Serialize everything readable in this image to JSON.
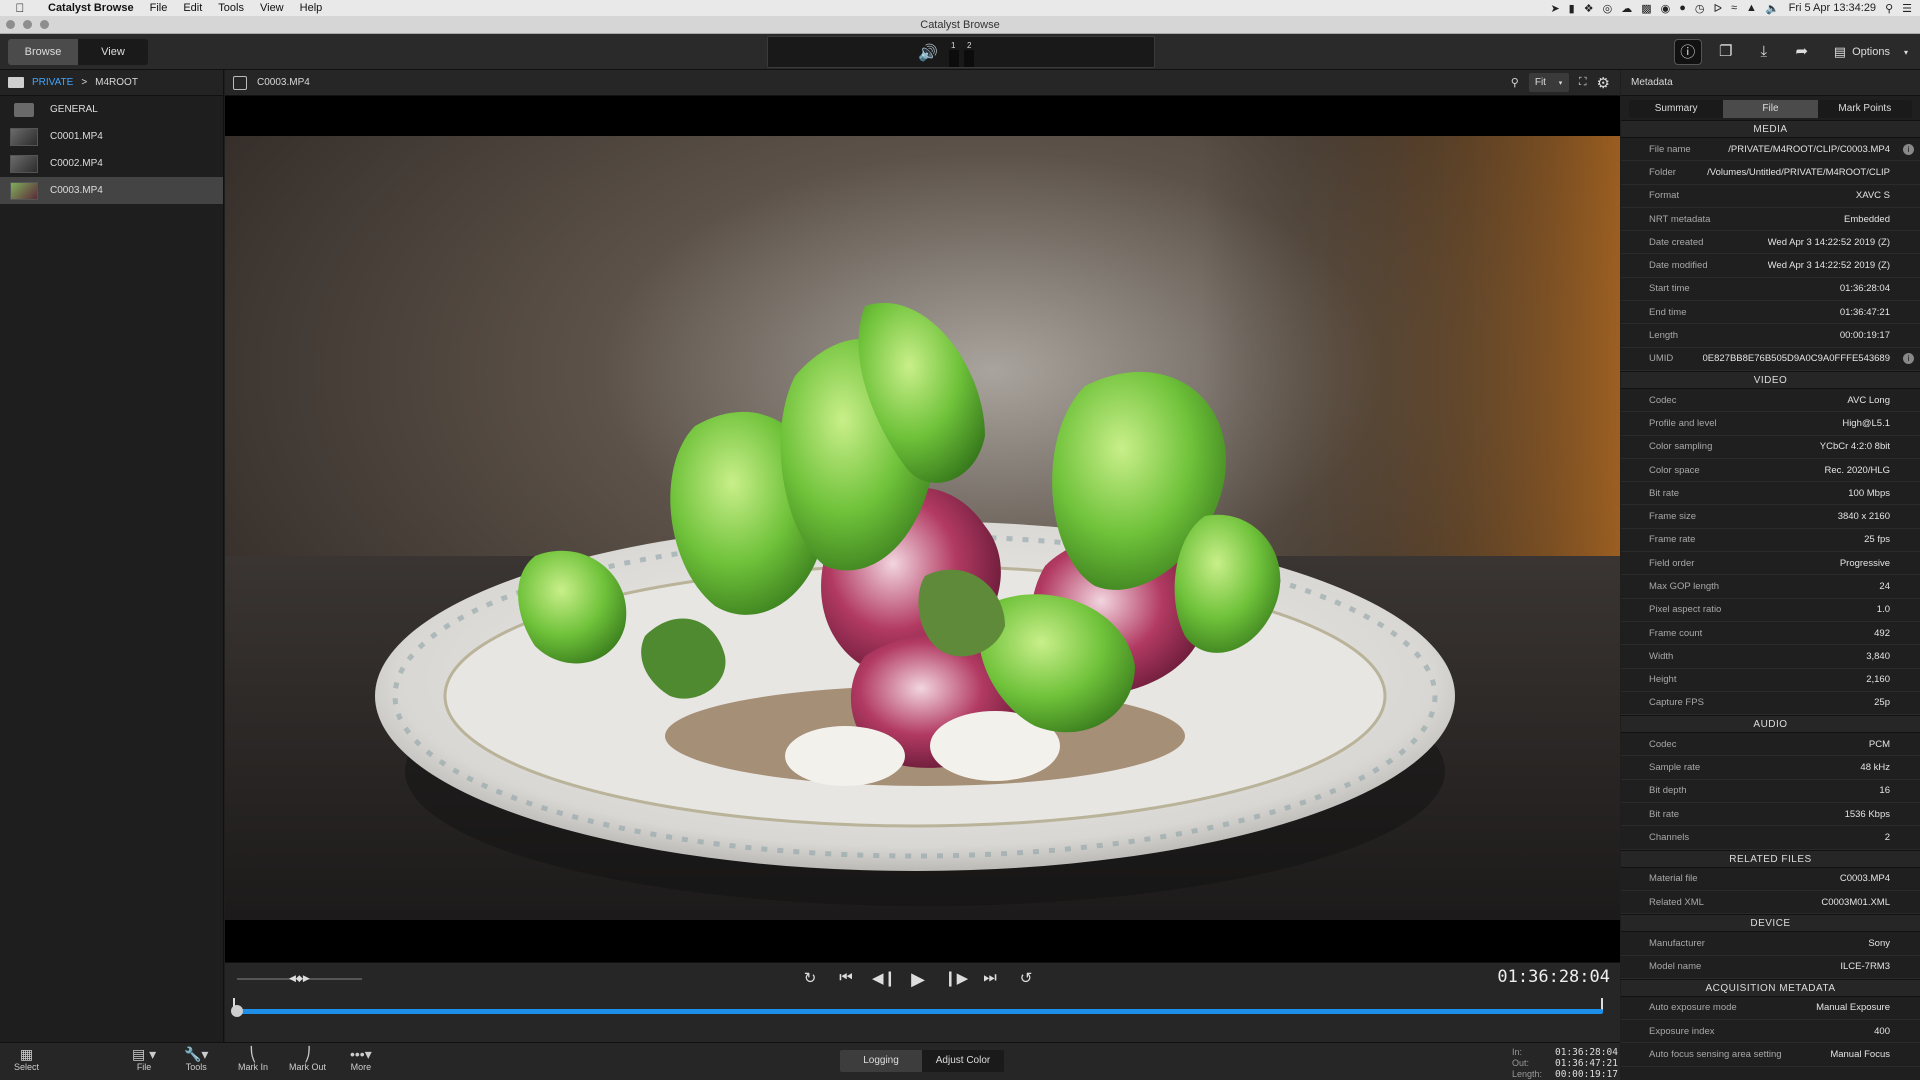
{
  "menubar": {
    "app": "Catalyst Browse",
    "items": [
      "File",
      "Edit",
      "Tools",
      "View",
      "Help"
    ],
    "clock": "Fri 5 Apr  13:34:29"
  },
  "window": {
    "title": "Catalyst Browse"
  },
  "toolbar": {
    "browse_label": "Browse",
    "view_label": "View",
    "audio_ch1": "1",
    "audio_ch2": "2",
    "options_label": "Options"
  },
  "browser": {
    "breadcrumb_root": "PRIVATE",
    "breadcrumb_sep": ">",
    "breadcrumb_current": "M4ROOT",
    "items": [
      {
        "label": "GENERAL",
        "type": "folder"
      },
      {
        "label": "C0001.MP4",
        "type": "clip"
      },
      {
        "label": "C0002.MP4",
        "type": "clip"
      },
      {
        "label": "C0003.MP4",
        "type": "clip",
        "selected": true
      }
    ]
  },
  "viewer": {
    "clip_name": "C0003.MP4",
    "fit_label": "Fit",
    "timecode": "01:36:28:04",
    "playhead_fraction": 0.0
  },
  "bottombar": {
    "select": "Select",
    "file": "File",
    "tools": "Tools",
    "mark_in": "Mark In",
    "mark_out": "Mark Out",
    "more": "More",
    "logging": "Logging",
    "adjust_color": "Adjust Color",
    "in_label": "In:",
    "out_label": "Out:",
    "length_label": "Length:",
    "in_value": "01:36:28:04",
    "out_value": "01:36:47:21",
    "length_value": "00:00:19:17"
  },
  "metadata": {
    "header": "Metadata",
    "tabs": [
      "Summary",
      "File",
      "Mark Points"
    ],
    "active_tab": "File",
    "sections": [
      {
        "title": "MEDIA",
        "rows": [
          {
            "k": "File name",
            "v": "/PRIVATE/M4ROOT/CLIP/C0003.MP4",
            "info": true
          },
          {
            "k": "Folder",
            "v": "/Volumes/Untitled/PRIVATE/M4ROOT/CLIP"
          },
          {
            "k": "Format",
            "v": "XAVC S"
          },
          {
            "k": "NRT metadata",
            "v": "Embedded"
          },
          {
            "k": "Date created",
            "v": "Wed Apr  3 14:22:52 2019 (Z)"
          },
          {
            "k": "Date modified",
            "v": "Wed Apr  3 14:22:52 2019 (Z)"
          },
          {
            "k": "Start time",
            "v": "01:36:28:04"
          },
          {
            "k": "End time",
            "v": "01:36:47:21"
          },
          {
            "k": "Length",
            "v": "00:00:19:17"
          },
          {
            "k": "UMID",
            "v": "0E827BB8E76B505D9A0C9A0FFFE543689",
            "info": true
          }
        ]
      },
      {
        "title": "VIDEO",
        "rows": [
          {
            "k": "Codec",
            "v": "AVC Long"
          },
          {
            "k": "Profile and level",
            "v": "High@L5.1"
          },
          {
            "k": "Color sampling",
            "v": "YCbCr 4:2:0 8bit"
          },
          {
            "k": "Color space",
            "v": "Rec. 2020/HLG"
          },
          {
            "k": "Bit rate",
            "v": "100 Mbps"
          },
          {
            "k": "Frame size",
            "v": "3840 x 2160"
          },
          {
            "k": "Frame rate",
            "v": "25 fps"
          },
          {
            "k": "Field order",
            "v": "Progressive"
          },
          {
            "k": "Max GOP length",
            "v": "24"
          },
          {
            "k": "Pixel aspect ratio",
            "v": "1.0"
          },
          {
            "k": "Frame count",
            "v": "492"
          },
          {
            "k": "Width",
            "v": "3,840"
          },
          {
            "k": "Height",
            "v": "2,160"
          },
          {
            "k": "Capture FPS",
            "v": "25p"
          }
        ]
      },
      {
        "title": "AUDIO",
        "rows": [
          {
            "k": "Codec",
            "v": "PCM"
          },
          {
            "k": "Sample rate",
            "v": "48 kHz"
          },
          {
            "k": "Bit depth",
            "v": "16"
          },
          {
            "k": "Bit rate",
            "v": "1536 Kbps"
          },
          {
            "k": "Channels",
            "v": "2"
          }
        ]
      },
      {
        "title": "RELATED FILES",
        "rows": [
          {
            "k": "Material file",
            "v": "C0003.MP4"
          },
          {
            "k": "Related XML",
            "v": "C0003M01.XML"
          }
        ]
      },
      {
        "title": "DEVICE",
        "rows": [
          {
            "k": "Manufacturer",
            "v": "Sony"
          },
          {
            "k": "Model name",
            "v": "ILCE-7RM3"
          }
        ]
      },
      {
        "title": "ACQUISITION METADATA",
        "rows": [
          {
            "k": "Auto exposure mode",
            "v": "Manual Exposure"
          },
          {
            "k": "Exposure index",
            "v": "400"
          },
          {
            "k": "Auto focus sensing area setting",
            "v": "Manual Focus"
          }
        ]
      }
    ]
  },
  "colors": {
    "accent": "#1e8fe8",
    "breadcrumb": "#3ea6ff"
  }
}
